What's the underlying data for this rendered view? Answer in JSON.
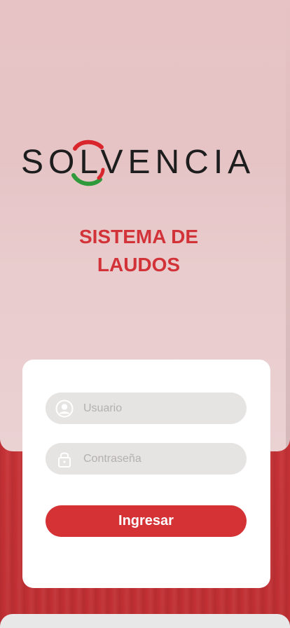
{
  "brand": {
    "logo_text": "SOLVENCIA",
    "logo_colors": {
      "red": "#d8262c",
      "green": "#2e9a3b",
      "dark": "#1d1d1d"
    }
  },
  "hero": {
    "title": "SISTEMA DE LAUDOS"
  },
  "login": {
    "username_placeholder": "Usuario",
    "password_placeholder": "Contraseña",
    "submit_label": "Ingresar",
    "user_icon": "user-circle-icon",
    "lock_icon": "lock-icon"
  },
  "colors": {
    "accent": "#d53236",
    "field_bg": "#e6e3e3",
    "background_red": "#c9363a"
  }
}
